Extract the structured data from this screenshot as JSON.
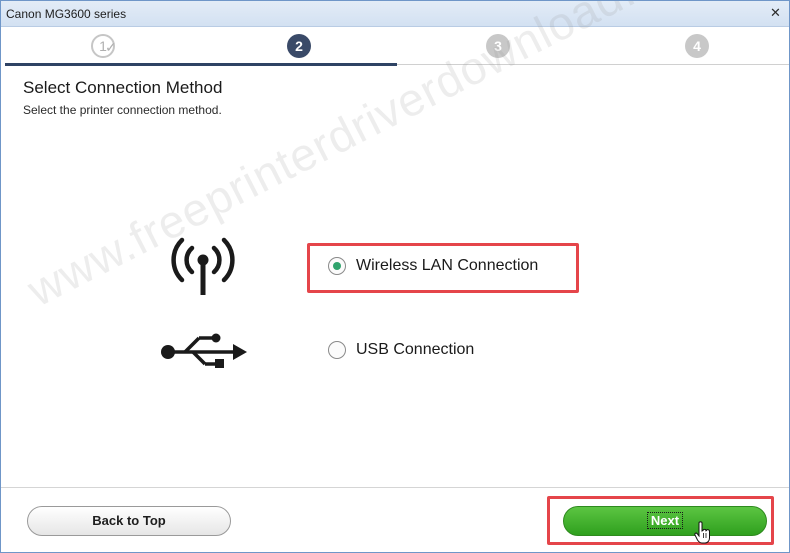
{
  "window": {
    "title": "Canon MG3600 series",
    "close_glyph": "✕"
  },
  "steps": [
    {
      "label": "1",
      "state": "done"
    },
    {
      "label": "2",
      "state": "active"
    },
    {
      "label": "3",
      "state": "future"
    },
    {
      "label": "4",
      "state": "future"
    }
  ],
  "step_check_glyph": "✓",
  "page": {
    "heading": "Select Connection Method",
    "subheading": "Select the printer connection method."
  },
  "options": [
    {
      "label": "Wireless LAN Connection",
      "selected": true,
      "icon": "wireless-antenna-icon"
    },
    {
      "label": "USB Connection",
      "selected": false,
      "icon": "usb-icon"
    }
  ],
  "buttons": {
    "back": "Back to Top",
    "next": "Next"
  },
  "watermark": "www.freeprinterdriverdownload.org",
  "colors": {
    "accent_progress": "#2f4364",
    "radio_selected": "#2fa36c",
    "next_button": "#3fb02a",
    "highlight": "#e5454a"
  }
}
